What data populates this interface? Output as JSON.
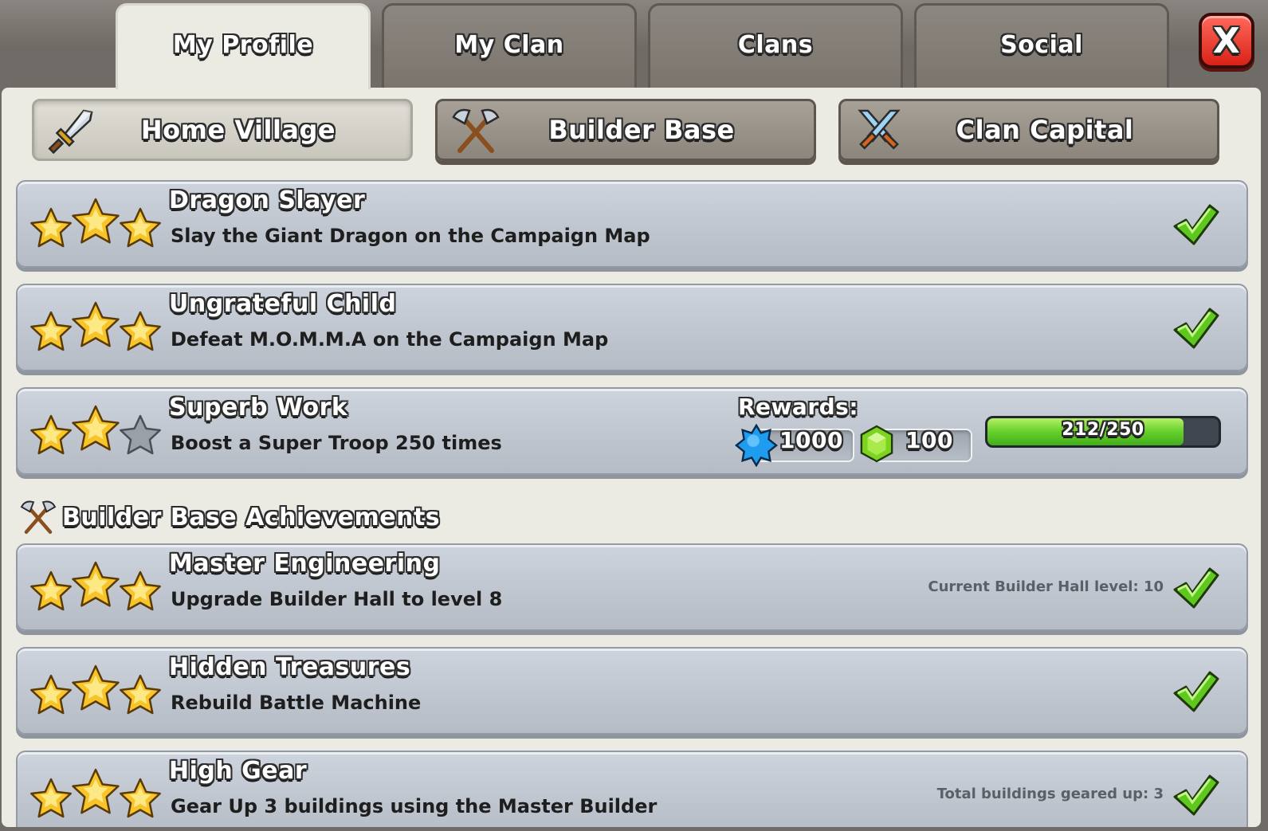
{
  "tabs": [
    {
      "label": "My Profile",
      "active": true
    },
    {
      "label": "My Clan",
      "active": false
    },
    {
      "label": "Clans",
      "active": false
    },
    {
      "label": "Social",
      "active": false
    }
  ],
  "close_label": "X",
  "subtabs": [
    {
      "label": "Home Village",
      "icon": "sword-icon",
      "active": true
    },
    {
      "label": "Builder Base",
      "icon": "crossed-axes-icon",
      "active": false
    },
    {
      "label": "Clan Capital",
      "icon": "crossed-swords-icon",
      "active": false
    }
  ],
  "achievements": [
    {
      "title": "Dragon Slayer",
      "description": "Slay the Giant Dragon on the Campaign Map",
      "stars": 3,
      "completed": true
    },
    {
      "title": "Ungrateful Child",
      "description": "Defeat M.O.M.M.A on the Campaign Map",
      "stars": 3,
      "completed": true
    },
    {
      "title": "Superb Work",
      "description": "Boost a Super Troop 250 times",
      "stars": 2,
      "completed": false,
      "rewards_label": "Rewards:",
      "reward_xp": "1000",
      "reward_gems": "100",
      "progress_text": "212/250",
      "progress_fraction": 0.848
    }
  ],
  "builder_section": {
    "title": "Builder Base Achievements",
    "icon": "crossed-axes-icon"
  },
  "builder_achievements": [
    {
      "title": "Master Engineering",
      "description": "Upgrade Builder Hall to level 8",
      "stars": 3,
      "completed": true,
      "note": "Current Builder Hall level: 10"
    },
    {
      "title": "Hidden Treasures",
      "description": "Rebuild Battle Machine",
      "stars": 3,
      "completed": true,
      "note": ""
    },
    {
      "title": "High Gear",
      "description": "Gear Up 3 buildings using the Master Builder",
      "stars": 3,
      "completed": true,
      "note": "Total buildings geared up: 3"
    }
  ],
  "colors": {
    "star_gold": "#f7c52a",
    "check_green": "#5fc81e",
    "progress_green": "#6bd22e",
    "xp_blue": "#1e9cf0",
    "gem_green": "#7ed321"
  }
}
